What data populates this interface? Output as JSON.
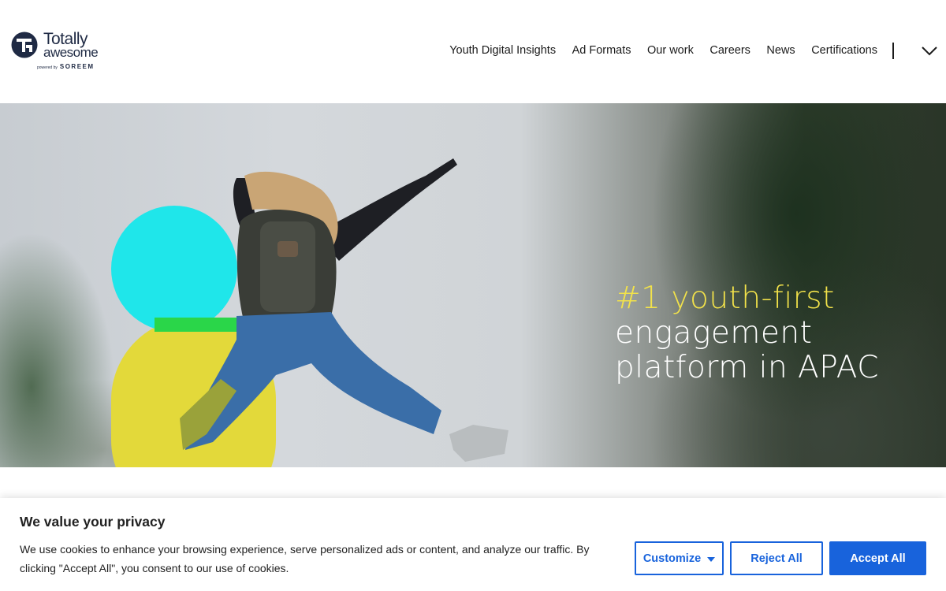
{
  "header": {
    "logo_line1": "Totally",
    "logo_line2": "awesome",
    "logo_powered": "powered by",
    "logo_brand": "SOREEM",
    "nav": [
      {
        "label": "Youth Digital Insights"
      },
      {
        "label": "Ad Formats"
      },
      {
        "label": "Our work"
      },
      {
        "label": "Careers"
      },
      {
        "label": "News"
      },
      {
        "label": "Certifications"
      }
    ],
    "menu_icon": "chevron-down-icon"
  },
  "hero": {
    "headline_line1": "#1 youth-first",
    "headline_line2": "engagement",
    "headline_line3": "platform in APAC",
    "colors": {
      "cyan": "#1fe6ea",
      "yellow": "#e3d93a",
      "green": "#2ad649",
      "highlight": "#f2e24a"
    }
  },
  "cookie": {
    "title": "We value your privacy",
    "body": "We use cookies to enhance your browsing experience, serve personalized ads or content, and analyze our traffic. By clicking \"Accept All\", you consent to our use of cookies.",
    "customize_label": "Customize",
    "reject_label": "Reject All",
    "accept_label": "Accept All",
    "accent_color": "#1863dc"
  }
}
